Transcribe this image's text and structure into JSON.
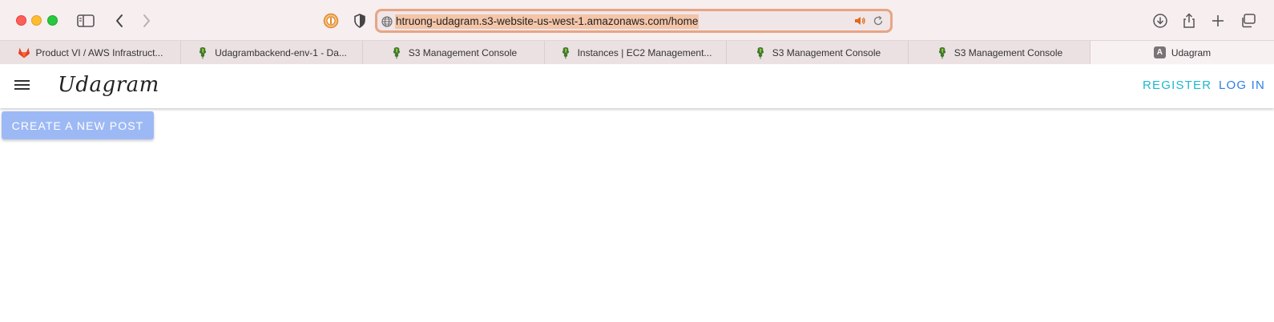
{
  "browser": {
    "url": "htruong-udagram.s3-website-us-west-1.amazonaws.com/home",
    "tabs": [
      {
        "label": "Product VI / AWS Infrastruct...",
        "icon": "gitlab-icon"
      },
      {
        "label": "Udagrambackend-env-1 - Da...",
        "icon": "beanstalk-icon"
      },
      {
        "label": "S3 Management Console",
        "icon": "beanstalk-icon"
      },
      {
        "label": "Instances | EC2 Management...",
        "icon": "beanstalk-icon"
      },
      {
        "label": "S3 Management Console",
        "icon": "beanstalk-icon"
      },
      {
        "label": "S3 Management Console",
        "icon": "beanstalk-icon"
      },
      {
        "label": "Udagram",
        "icon": "letter-a-icon",
        "favicon_letter": "A",
        "active": true
      }
    ]
  },
  "app": {
    "brand": "Udagram",
    "nav": {
      "register": "REGISTER",
      "login": "LOG IN"
    },
    "create_post_label": "CREATE A NEW POST"
  },
  "colors": {
    "register": "#1fb8c9",
    "login": "#2f7ee6",
    "create_button": "#9db9f5",
    "url_highlight": "#f4c5a8"
  }
}
